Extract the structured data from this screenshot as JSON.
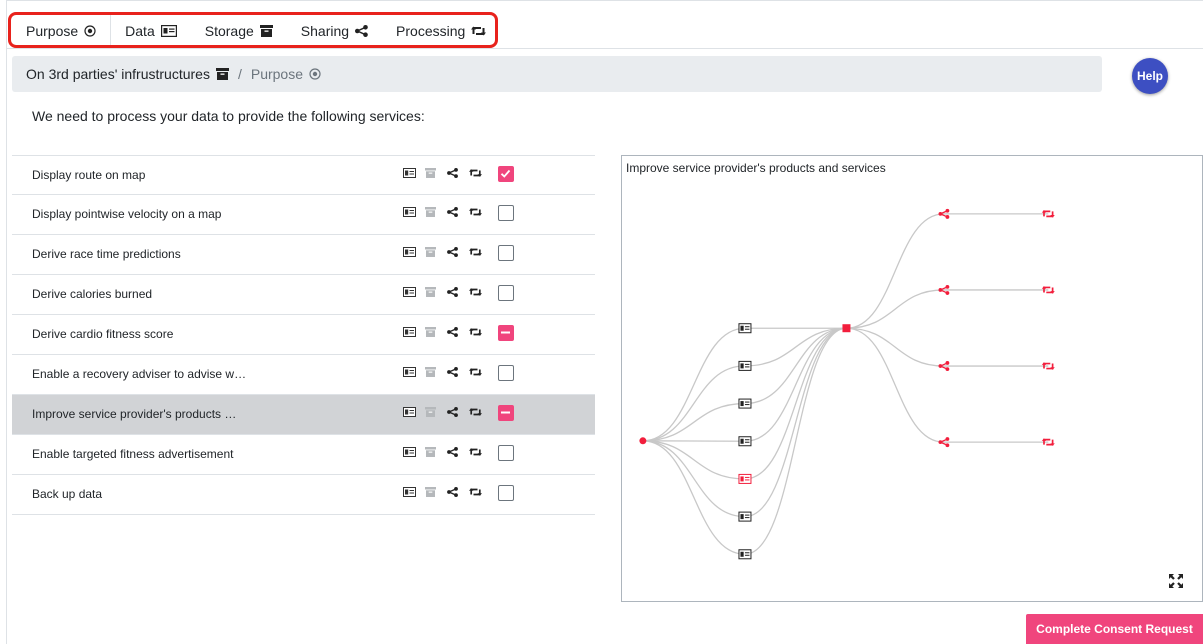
{
  "tabs": [
    {
      "label": "Purpose",
      "icon": "target-icon"
    },
    {
      "label": "Data",
      "icon": "id-card-icon"
    },
    {
      "label": "Storage",
      "icon": "archive-icon"
    },
    {
      "label": "Sharing",
      "icon": "share-icon"
    },
    {
      "label": "Processing",
      "icon": "retweet-icon"
    }
  ],
  "breadcrumb": {
    "parent": "On 3rd parties' infrustructures",
    "separator": "/",
    "current": "Purpose"
  },
  "help_label": "Help",
  "intro": "We need to process your data to provide the following services:",
  "services": [
    {
      "label": "Display route on map",
      "state": "checked"
    },
    {
      "label": "Display pointwise velocity on a map",
      "state": "unchecked"
    },
    {
      "label": "Derive race time predictions",
      "state": "unchecked"
    },
    {
      "label": "Derive calories burned",
      "state": "unchecked"
    },
    {
      "label": "Derive cardio fitness score",
      "state": "partial"
    },
    {
      "label": "Enable a recovery adviser to advise w…",
      "state": "unchecked"
    },
    {
      "label": "Improve service provider's products …",
      "state": "partial",
      "selected": true
    },
    {
      "label": "Enable targeted fitness advertisement",
      "state": "unchecked"
    },
    {
      "label": "Back up data",
      "state": "unchecked"
    }
  ],
  "graph": {
    "title": "Improve service provider's products and services",
    "data_nodes": 7,
    "highlighted_data_node": 4,
    "sharing_nodes": 4,
    "processing_nodes": 4
  },
  "colors": {
    "accent": "#f0457d",
    "graph_red": "#f21e3c",
    "help": "#3d4fc2",
    "highlight_border": "#e8221c"
  },
  "complete_button": "Complete Consent Request"
}
